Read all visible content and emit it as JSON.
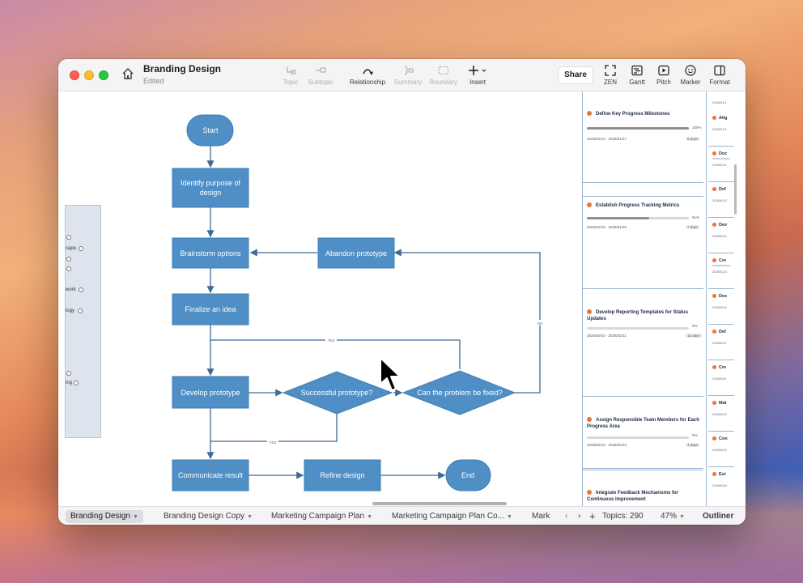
{
  "window": {
    "title": "Branding Design",
    "status": "Edited",
    "share_label": "Share"
  },
  "toolbar": {
    "topic": "Topic",
    "subtopic": "Subtopic",
    "relationship": "Relationship",
    "summary": "Summary",
    "boundary": "Boundary",
    "insert": "Insert",
    "zen": "ZEN",
    "gantt": "Gantt",
    "pitch": "Pitch",
    "marker": "Marker",
    "format": "Format"
  },
  "flowchart": {
    "start": "Start",
    "identify_line1": "Identify purpose of",
    "identify_line2": "design",
    "brainstorm": "Brainstorm options",
    "abandon": "Abandon prototype",
    "finalize": "Finalize an idea",
    "develop": "Develop prototype",
    "successful": "Successful prototype?",
    "can_fix": "Can the problem be fixed?",
    "communicate": "Communicate result",
    "refine": "Refine design",
    "end": "End",
    "yes_top": "YES",
    "yes_bottom": "YES",
    "no_label": "NO",
    "colors": {
      "node": "#4f8fc6",
      "node_border": "#3f7cb2",
      "line": "#3e6a95"
    }
  },
  "left_strip": {
    "labels": [
      "cape",
      "work",
      "logy",
      "ing"
    ]
  },
  "gantt": {
    "tasks": [
      {
        "title": "Define Key Progress Milestones",
        "pct": "100%",
        "progress": 1.0,
        "dates": "2026/01/13 - 2026/01/17",
        "days": "5 days"
      },
      {
        "title": "Establish Progress Tracking Metrics",
        "pct": "61%",
        "progress": 0.61,
        "dates": "2026/01/19 - 2026/01/26",
        "days": "7 days"
      },
      {
        "title": "Develop Reporting Templates for Status Updates",
        "pct": "0%",
        "progress": 0.0,
        "dates": "2026/02/02 - 2026/02/11",
        "days": "10 days"
      },
      {
        "title": "Assign Responsible Team Members for Each Progress Area",
        "pct": "0%",
        "progress": 0.0,
        "dates": "2026/02/19 - 2026/02/23",
        "days": "4 days"
      },
      {
        "title": "Integrate Feedback Mechanisms for Continuous Improvement",
        "pct": "",
        "progress": 0.0,
        "dates": "",
        "days": ""
      }
    ],
    "mini": [
      {
        "title": "Alig",
        "date": "2026/01/1"
      },
      {
        "title": "Doc",
        "date": "2026/01/1"
      },
      {
        "title": "Def",
        "date": "2026/01/2"
      },
      {
        "title": "Dev",
        "date": "2026/01/2"
      },
      {
        "title": "Cre",
        "date": "2026/01/3"
      },
      {
        "title": "Des",
        "date": "2026/02/0"
      },
      {
        "title": "Def",
        "date": "2026/02/1"
      },
      {
        "title": "Cre",
        "date": "2026/02/1"
      },
      {
        "title": "Mat",
        "date": "2026/02/2"
      },
      {
        "title": "Con",
        "date": "2026/02/2"
      },
      {
        "title": "Est",
        "date": "2026/03/0"
      }
    ],
    "top_date": "2026/01/1"
  },
  "bottombar": {
    "tabs": [
      "Branding Design",
      "Branding Design Copy",
      "Marketing Campaign Plan",
      "Marketing Campaign Plan Co...",
      "Mark"
    ],
    "topics": "Topics: 290",
    "zoom": "47%",
    "outliner": "Outliner"
  }
}
